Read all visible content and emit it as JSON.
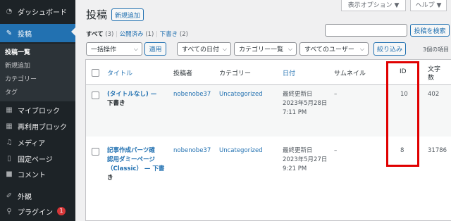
{
  "sidebar": {
    "dashboard": "ダッシュボード",
    "posts": "投稿",
    "submenu": [
      "投稿一覧",
      "新規追加",
      "カテゴリー",
      "タグ"
    ],
    "items": [
      {
        "label": "マイブロック",
        "icon": "grid-icon"
      },
      {
        "label": "再利用ブロック",
        "icon": "grid-icon"
      },
      {
        "label": "メディア",
        "icon": "media-icon"
      },
      {
        "label": "固定ページ",
        "icon": "page-icon"
      },
      {
        "label": "コメント",
        "icon": "comment-icon"
      },
      {
        "label": "外観",
        "icon": "brush-icon"
      },
      {
        "label": "プラグイン",
        "icon": "plugin-icon",
        "badge": "1"
      }
    ]
  },
  "header": {
    "title": "投稿",
    "add_new": "新規追加",
    "screen_options": "表示オプション ▼",
    "help": "ヘルプ ▼"
  },
  "filters": {
    "all": "すべて",
    "all_count": "(3)",
    "published": "公開済み",
    "published_count": "(1)",
    "drafts": "下書き",
    "drafts_count": "(2)",
    "sep": "|"
  },
  "search": {
    "button": "投稿を検索",
    "value": ""
  },
  "toolbar": {
    "bulk": "一括操作",
    "apply": "適用",
    "dates": "すべての日付",
    "categories": "カテゴリー一覧",
    "users": "すべてのユーザー",
    "filter": "絞り込み",
    "count": "3個の項目"
  },
  "table": {
    "headers": {
      "title": "タイトル",
      "author": "投稿者",
      "category": "カテゴリー",
      "date": "日付",
      "thumbnail": "サムネイル",
      "id": "ID",
      "chars_1": "文字",
      "chars_2": "数"
    },
    "rows": [
      {
        "title_lines": [
          "(タイトルなし) —",
          "下書き"
        ],
        "author": "nobenobe37",
        "category": "Uncategorized",
        "date_lines": [
          "最終更新日",
          "2023年5月28日",
          "7:11 PM"
        ],
        "thumbnail": "–",
        "id": "10",
        "chars": "402"
      },
      {
        "title_lines": [
          "記事作成パーツ確",
          "認用ダミーページ",
          "（Classic） — 下書",
          "き"
        ],
        "author": "nobenobe37",
        "category": "Uncategorized",
        "date_lines": [
          "最終更新日",
          "2023年5月27日",
          "9:21 PM"
        ],
        "thumbnail": "–",
        "id": "8",
        "chars": "31786"
      }
    ]
  },
  "colors": {
    "accent": "#2271b1",
    "sidebar": "#1d2327",
    "highlight": "#e00000"
  }
}
